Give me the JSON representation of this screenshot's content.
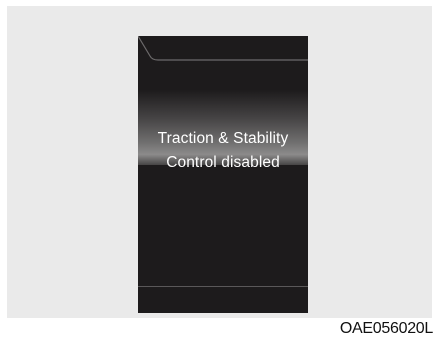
{
  "display": {
    "message_line1": "Traction & Stability",
    "message_line2": "Control disabled"
  },
  "figure_code": "OAE056020L",
  "colors": {
    "panel_background": "#eaeaea",
    "display_background": "#1d1b1c",
    "message_text": "#ffffff"
  }
}
